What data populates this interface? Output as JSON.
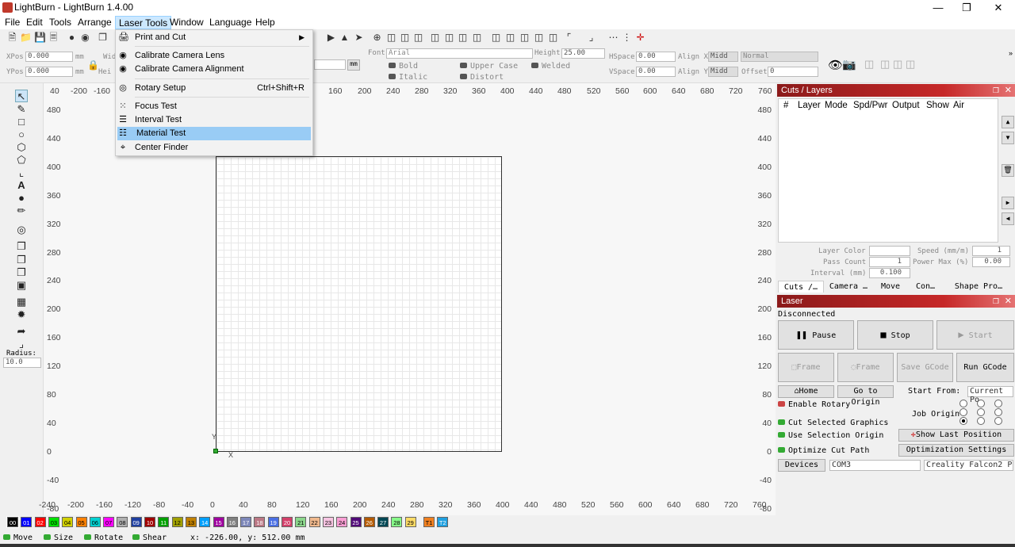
{
  "window": {
    "title": "LightBurn - LightBurn 1.4.00"
  },
  "menubar": {
    "items": [
      "File",
      "Edit",
      "Tools",
      "Arrange",
      "Laser Tools",
      "Window",
      "Language",
      "Help"
    ]
  },
  "laser_tools_menu": {
    "items": [
      {
        "label": "Print and Cut",
        "shortcut": "",
        "submenu": true,
        "icon": "print-cut-icon"
      },
      {
        "label": "Calibrate Camera Lens",
        "shortcut": "",
        "icon": "camera-icon"
      },
      {
        "label": "Calibrate Camera Alignment",
        "shortcut": "",
        "icon": "camera-icon"
      },
      {
        "label": "Rotary Setup",
        "shortcut": "Ctrl+Shift+R",
        "icon": "rotary-icon"
      },
      {
        "label": "Focus Test",
        "shortcut": "",
        "icon": "focus-icon"
      },
      {
        "label": "Interval Test",
        "shortcut": "",
        "icon": "interval-icon"
      },
      {
        "label": "Material Test",
        "shortcut": "",
        "icon": "grid-icon",
        "highlighted": true
      },
      {
        "label": "Center Finder",
        "shortcut": "",
        "icon": "target-icon"
      }
    ]
  },
  "props": {
    "xpos_label": "XPos",
    "xpos_value": "0.000",
    "ypos_label": "YPos",
    "ypos_value": "0.000",
    "unit": "mm",
    "wid_label": "Wid",
    "hei_label": "Hei",
    "font_label": "Font",
    "font_value": "Arial",
    "height_label": "Height",
    "height_value": "25.00",
    "hspace_label": "HSpace",
    "hspace_value": "0.00",
    "vspace_label": "VSpace",
    "vspace_value": "0.00",
    "alignx_label": "Align X",
    "alignx_value": "Midd",
    "aligny_label": "Align Y",
    "aligny_value": "Midd",
    "normal_value": "Normal",
    "offset_label": "Offset",
    "offset_value": "0",
    "bold": "Bold",
    "italic": "Italic",
    "upper_case": "Upper Case",
    "distort": "Distort",
    "welded": "Welded",
    "mm_button": "mm"
  },
  "left_tools": {
    "radius_label": "Radius:",
    "radius_value": "10.0"
  },
  "rulers": {
    "top": [
      "40",
      "-200",
      "-160",
      "160",
      "200",
      "240",
      "280",
      "320",
      "360",
      "400",
      "440",
      "480",
      "520",
      "560",
      "600",
      "640",
      "680",
      "720",
      "760"
    ],
    "bottom": [
      "-240",
      "-200",
      "-160",
      "-120",
      "-80",
      "-40",
      "0",
      "40",
      "80",
      "120",
      "160",
      "200",
      "240",
      "280",
      "320",
      "360",
      "400",
      "440",
      "480",
      "520",
      "560",
      "600",
      "640",
      "680",
      "720",
      "760"
    ],
    "left": [
      "480",
      "440",
      "400",
      "360",
      "320",
      "280",
      "240",
      "200",
      "160",
      "120",
      "80",
      "40",
      "0",
      "-40",
      "-80"
    ],
    "right": [
      "480",
      "440",
      "400",
      "360",
      "320",
      "280",
      "240",
      "200",
      "160",
      "120",
      "80",
      "40",
      "0",
      "-40",
      "-80"
    ],
    "origin_y": "Y",
    "origin_x": "X"
  },
  "cuts_panel": {
    "title": "Cuts / Layers",
    "columns": [
      "#",
      "Layer",
      "Mode",
      "Spd/Pwr",
      "Output",
      "Show",
      "Air"
    ],
    "layer_color_label": "Layer Color",
    "speed_label": "Speed (mm/m)",
    "speed_value": "1",
    "pass_count_label": "Pass Count",
    "pass_count_value": "1",
    "power_max_label": "Power Max (%)",
    "power_max_value": "0.00",
    "interval_label": "Interval (mm)",
    "interval_value": "0.100",
    "tabs": [
      "Cuts /…",
      "Camera …",
      "Move",
      "Con…",
      "Shape Pro…"
    ]
  },
  "laser_panel": {
    "title": "Laser",
    "status": "Disconnected",
    "pause": "Pause",
    "stop": "Stop",
    "start": "Start",
    "frame1": "Frame",
    "frame2": "Frame",
    "save_gcode": "Save GCode",
    "run_gcode": "Run GCode",
    "home": "Home",
    "go_to_origin": "Go to Origin",
    "start_from_label": "Start From:",
    "start_from_value": "Current Po",
    "enable_rotary": "Enable Rotary",
    "job_origin": "Job Origin",
    "cut_selected": "Cut Selected Graphics",
    "use_selection_origin": "Use Selection Origin",
    "optimize_cut_path": "Optimize Cut Path",
    "show_last_position": "Show Last Position",
    "optimization_settings": "Optimization Settings",
    "devices": "Devices",
    "port": "COM3",
    "device_name": "Creality Falcon2 P"
  },
  "palette": [
    {
      "l": "00",
      "c": "#000000",
      "t": "#fff"
    },
    {
      "l": "01",
      "c": "#0000ff",
      "t": "#fff"
    },
    {
      "l": "02",
      "c": "#ff0000",
      "t": "#fff"
    },
    {
      "l": "03",
      "c": "#00e000",
      "t": "#000"
    },
    {
      "l": "04",
      "c": "#d0d000",
      "t": "#000"
    },
    {
      "l": "05",
      "c": "#ff8000",
      "t": "#000"
    },
    {
      "l": "06",
      "c": "#00d0d0",
      "t": "#000"
    },
    {
      "l": "07",
      "c": "#ff00ff",
      "t": "#000"
    },
    {
      "l": "08",
      "c": "#b0b0b0",
      "t": "#000"
    },
    {
      "l": "09",
      "c": "#1f3fa0",
      "t": "#fff"
    },
    {
      "l": "10",
      "c": "#a00000",
      "t": "#fff"
    },
    {
      "l": "11",
      "c": "#00a000",
      "t": "#fff"
    },
    {
      "l": "12",
      "c": "#a0a000",
      "t": "#000"
    },
    {
      "l": "13",
      "c": "#c08000",
      "t": "#000"
    },
    {
      "l": "14",
      "c": "#00a0ff",
      "t": "#fff"
    },
    {
      "l": "15",
      "c": "#a000a0",
      "t": "#fff"
    },
    {
      "l": "16",
      "c": "#808080",
      "t": "#fff"
    },
    {
      "l": "17",
      "c": "#7d87b9",
      "t": "#fff"
    },
    {
      "l": "18",
      "c": "#bb7784",
      "t": "#fff"
    },
    {
      "l": "19",
      "c": "#4a6fe3",
      "t": "#fff"
    },
    {
      "l": "20",
      "c": "#d33f6a",
      "t": "#fff"
    },
    {
      "l": "21",
      "c": "#8cd78c",
      "t": "#000"
    },
    {
      "l": "22",
      "c": "#f0b98d",
      "t": "#000"
    },
    {
      "l": "23",
      "c": "#f6c4e1",
      "t": "#000"
    },
    {
      "l": "24",
      "c": "#fa9ed4",
      "t": "#000"
    },
    {
      "l": "25",
      "c": "#500a78",
      "t": "#fff"
    },
    {
      "l": "26",
      "c": "#b45a00",
      "t": "#fff"
    },
    {
      "l": "27",
      "c": "#004754",
      "t": "#fff"
    },
    {
      "l": "28",
      "c": "#86fa88",
      "t": "#000"
    },
    {
      "l": "29",
      "c": "#ffdb66",
      "t": "#000"
    },
    {
      "l": "T1",
      "c": "#f08020",
      "t": "#000"
    },
    {
      "l": "T2",
      "c": "#20a0e0",
      "t": "#fff"
    }
  ],
  "status": {
    "move": "Move",
    "size": "Size",
    "rotate": "Rotate",
    "shear": "Shear",
    "coords": "x: -226.00, y: 512.00 mm"
  }
}
